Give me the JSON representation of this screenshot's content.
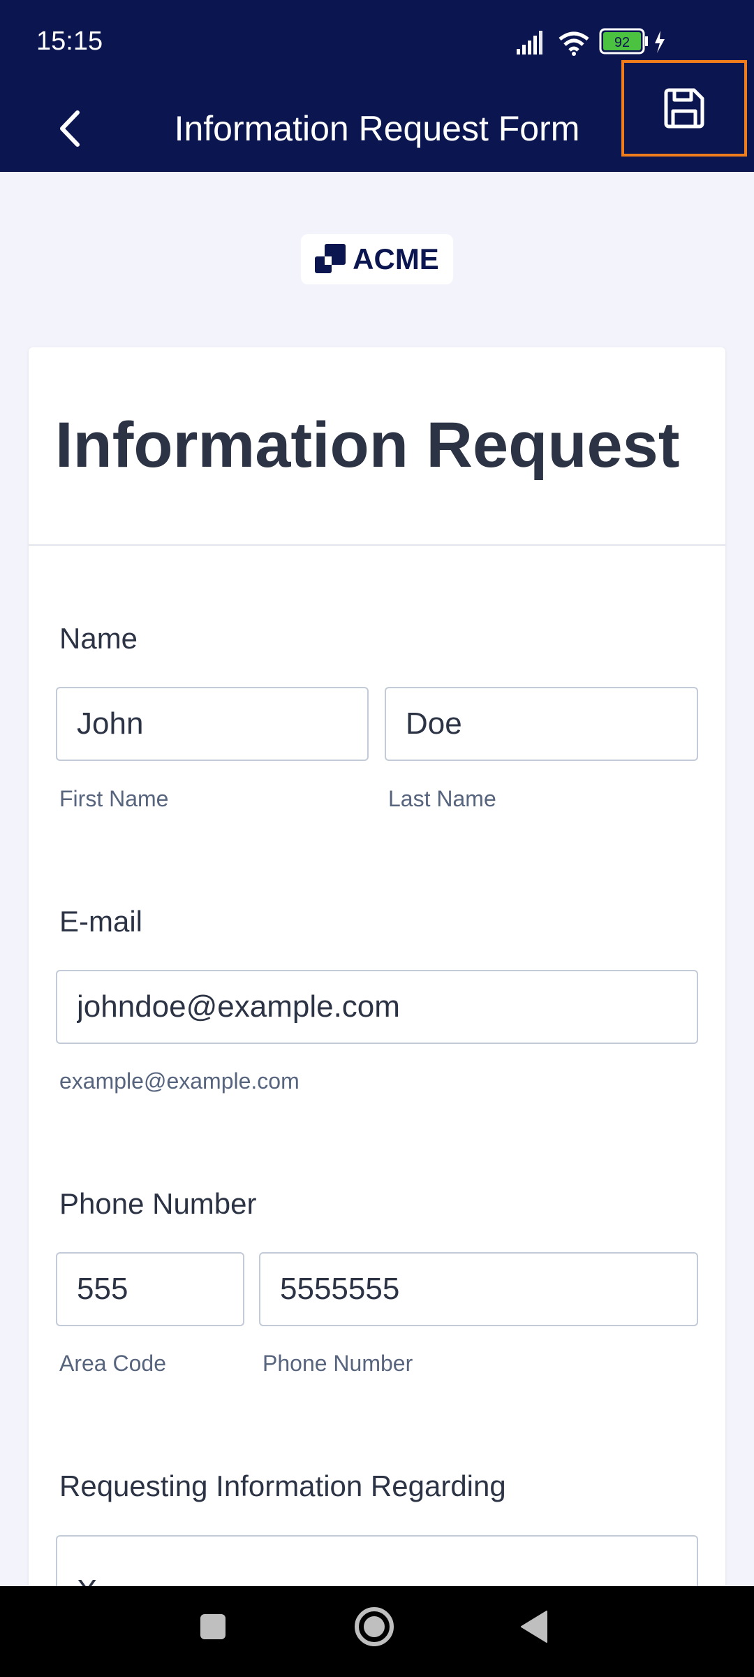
{
  "status_bar": {
    "time": "15:15",
    "battery_level": "92",
    "icons": [
      "signal-icon",
      "wifi-icon",
      "battery-icon",
      "charging-icon"
    ]
  },
  "app_bar": {
    "title": "Information Request Form",
    "back_icon": "chevron-left-icon",
    "save_icon": "save-icon"
  },
  "logo": {
    "text": "ACME"
  },
  "form": {
    "title": "Information Request",
    "name": {
      "label": "Name",
      "first_value": "John",
      "first_sublabel": "First Name",
      "last_value": "Doe",
      "last_sublabel": "Last Name"
    },
    "email": {
      "label": "E-mail",
      "value": "johndoe@example.com",
      "sublabel": "example@example.com"
    },
    "phone": {
      "label": "Phone Number",
      "area_value": "555",
      "area_sublabel": "Area Code",
      "number_value": "5555555",
      "number_sublabel": "Phone Number"
    },
    "request": {
      "label": "Requesting Information Regarding",
      "value": "X"
    }
  },
  "colors": {
    "header": "#0b1650",
    "highlight": "#f07c1b",
    "background": "#f3f3fb",
    "text": "#2c3345"
  }
}
